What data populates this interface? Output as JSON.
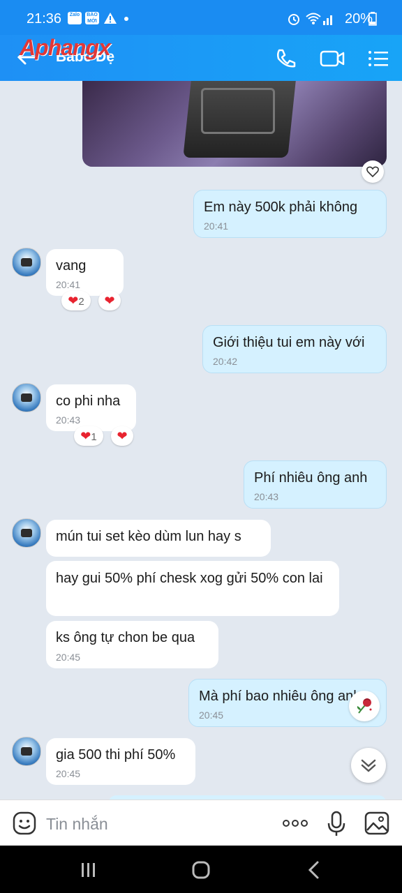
{
  "status": {
    "time": "21:36",
    "icon1": "Zalo",
    "icon2a": "BÁO",
    "icon2b": "MỚI",
    "battery": "20%"
  },
  "header": {
    "contact_name": "Babe Đẹ",
    "watermark": "Aphangx"
  },
  "messages": [
    {
      "dir": "out",
      "text": "Em này 500k phải không",
      "time": "20:41"
    },
    {
      "dir": "in",
      "text": "vang",
      "time": "20:41",
      "reactions": {
        "count": "2"
      }
    },
    {
      "dir": "out",
      "text": "Giới thiệu tui em này với",
      "time": "20:42"
    },
    {
      "dir": "in",
      "text": "co phi nha",
      "time": "20:43",
      "reactions": {
        "count": "1"
      }
    },
    {
      "dir": "out",
      "text": "Phí nhiêu ông anh",
      "time": "20:43"
    },
    {
      "dir": "in",
      "text": "mún tui set kèo dùm lun hay s"
    },
    {
      "dir": "in",
      "text": "hay gui 50% phí chesk xog gửi 50% con lai"
    },
    {
      "dir": "in",
      "text": "ks ông tự chon be qua",
      "time": "20:45"
    },
    {
      "dir": "out",
      "text": "Mà phí bao nhiêu ông anh",
      "time": "20:45"
    },
    {
      "dir": "in",
      "text": "gia 500 thi phí 50%",
      "time": "20:45"
    }
  ],
  "composer": {
    "placeholder": "Tin nhắn"
  },
  "colors": {
    "header": "#1a8cf2",
    "outgoing_bubble": "#d5f1ff",
    "incoming_bubble": "#ffffff",
    "background": "#e2e8f0",
    "heart": "#e8232f"
  }
}
